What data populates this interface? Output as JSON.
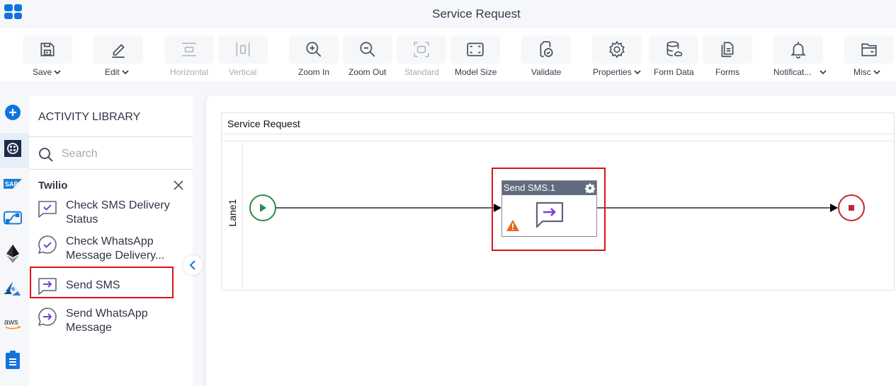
{
  "header": {
    "title": "Service Request"
  },
  "toolbar": {
    "items": [
      {
        "label": "Save",
        "icon": "save-icon",
        "dropdown": true,
        "enabled": true
      },
      {
        "label": "Edit",
        "icon": "edit-icon",
        "dropdown": true,
        "enabled": true
      },
      {
        "label": "Horizontal",
        "icon": "horizontal-layout-icon",
        "dropdown": false,
        "enabled": false
      },
      {
        "label": "Vertical",
        "icon": "vertical-layout-icon",
        "dropdown": false,
        "enabled": false
      },
      {
        "label": "Zoom In",
        "icon": "zoom-in-icon",
        "dropdown": false,
        "enabled": true
      },
      {
        "label": "Zoom Out",
        "icon": "zoom-out-icon",
        "dropdown": false,
        "enabled": true
      },
      {
        "label": "Standard",
        "icon": "standard-size-icon",
        "dropdown": false,
        "enabled": false
      },
      {
        "label": "Model Size",
        "icon": "model-size-icon",
        "dropdown": false,
        "enabled": true
      },
      {
        "label": "Validate",
        "icon": "validate-icon",
        "dropdown": false,
        "enabled": true
      },
      {
        "label": "Properties",
        "icon": "gear-icon",
        "dropdown": true,
        "enabled": true
      },
      {
        "label": "Form Data",
        "icon": "database-icon",
        "dropdown": false,
        "enabled": true
      },
      {
        "label": "Forms",
        "icon": "forms-icon",
        "dropdown": false,
        "enabled": true
      },
      {
        "label": "Notificat...",
        "icon": "bell-icon",
        "dropdown": true,
        "enabled": true
      },
      {
        "label": "Misc",
        "icon": "folder-icon",
        "dropdown": true,
        "enabled": true
      }
    ]
  },
  "left_rail": {
    "items": [
      {
        "name": "add",
        "icon": "plus-circle-icon"
      },
      {
        "name": "twilio",
        "icon": "twilio-icon",
        "active": true
      },
      {
        "name": "sap",
        "icon": "sap-icon",
        "text": "SAP"
      },
      {
        "name": "workflow",
        "icon": "flow-icon"
      },
      {
        "name": "ethereum",
        "icon": "ethereum-icon"
      },
      {
        "name": "azure",
        "icon": "azure-icon"
      },
      {
        "name": "aws",
        "icon": "aws-icon",
        "text": "aws"
      },
      {
        "name": "clipboard",
        "icon": "clipboard-icon"
      }
    ]
  },
  "library": {
    "title": "ACTIVITY LIBRARY",
    "search_placeholder": "Search",
    "group": "Twilio",
    "activities": [
      {
        "label": "Check SMS Delivery Status",
        "line1": "Check SMS Delivery",
        "line2": "Status",
        "icon": "sms-check-icon"
      },
      {
        "label": "Check WhatsApp Message Delivery...",
        "line1": "Check WhatsApp",
        "line2": "Message Delivery...",
        "icon": "whatsapp-check-icon"
      },
      {
        "label": "Send SMS",
        "line1": "Send SMS",
        "line2": "",
        "icon": "sms-send-icon",
        "highlighted": true
      },
      {
        "label": "Send WhatsApp Message",
        "line1": "Send WhatsApp",
        "line2": "Message",
        "icon": "whatsapp-send-icon"
      }
    ]
  },
  "canvas": {
    "pool_title": "Service Request",
    "lane_label": "Lane1",
    "task": {
      "title": "Send SMS.1",
      "warning": true,
      "highlighted": true
    },
    "colors": {
      "start": "#2e8b4a",
      "end": "#c0272d",
      "task_header": "#636b80",
      "highlight": "#e01019",
      "warning": "#e06a1b",
      "accent": "#7b3fd6"
    }
  }
}
